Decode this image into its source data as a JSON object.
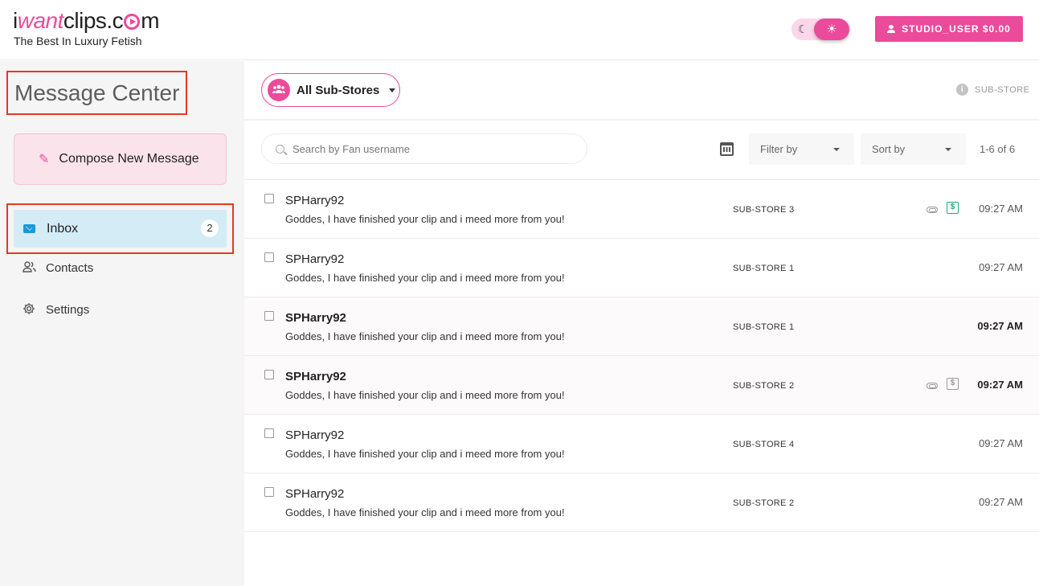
{
  "header": {
    "logo": {
      "prefix": "i",
      "accent": "want",
      "suffix": "clips.c",
      "end": "m"
    },
    "tagline": "The Best In Luxury Fetish",
    "user_button_label": "STUDIO_USER $0.00",
    "theme_toggle": {
      "moon_icon": "☾",
      "sun_icon": "☀",
      "active": "light"
    }
  },
  "sidebar": {
    "title": "Message Center",
    "compose_label": "Compose New Message",
    "nav": [
      {
        "label": "Inbox",
        "badge": "2",
        "icon": "envelope-icon",
        "active": true
      },
      {
        "label": "Contacts",
        "icon": "contacts-icon"
      },
      {
        "label": "Settings",
        "icon": "gear-icon"
      }
    ]
  },
  "toolbar": {
    "substores_label": "All Sub-Stores",
    "substore_info_label": "SUB-STORE",
    "search_placeholder": "Search by Fan username",
    "filter_label": "Filter by",
    "sort_label": "Sort by",
    "range_label": "1-6 of 6"
  },
  "messages": [
    {
      "sender": "SPHarry92",
      "preview": "Goddes, I have finished your clip and i meed more from you!",
      "store": "SUB-STORE 3",
      "time": "09:27 AM",
      "unread": false,
      "attachment": true,
      "paid": "green"
    },
    {
      "sender": "SPHarry92",
      "preview": "Goddes, I have finished your clip and i meed more from you!",
      "store": "SUB-STORE 1",
      "time": "09:27 AM",
      "unread": false
    },
    {
      "sender": "SPHarry92",
      "preview": "Goddes, I have finished your clip and i meed more from you!",
      "store": "SUB-STORE 1",
      "time": "09:27 AM",
      "unread": true
    },
    {
      "sender": "SPHarry92",
      "preview": "Goddes, I have finished your clip and i meed more from you!",
      "store": "SUB-STORE 2",
      "time": "09:27 AM",
      "unread": true,
      "attachment": true,
      "paid": "gray"
    },
    {
      "sender": "SPHarry92",
      "preview": "Goddes, I have finished your clip and i meed more from you!",
      "store": "SUB-STORE 4",
      "time": "09:27 AM",
      "unread": false
    },
    {
      "sender": "SPHarry92",
      "preview": "Goddes, I have finished your clip and i meed more from you!",
      "store": "SUB-STORE 2",
      "time": "09:27 AM",
      "unread": false
    }
  ],
  "colors": {
    "brand_pink": "#ec4a9a",
    "highlight_red": "#e53922",
    "inbox_active_bg": "#d3ecf6",
    "paid_green": "#21a77c"
  }
}
